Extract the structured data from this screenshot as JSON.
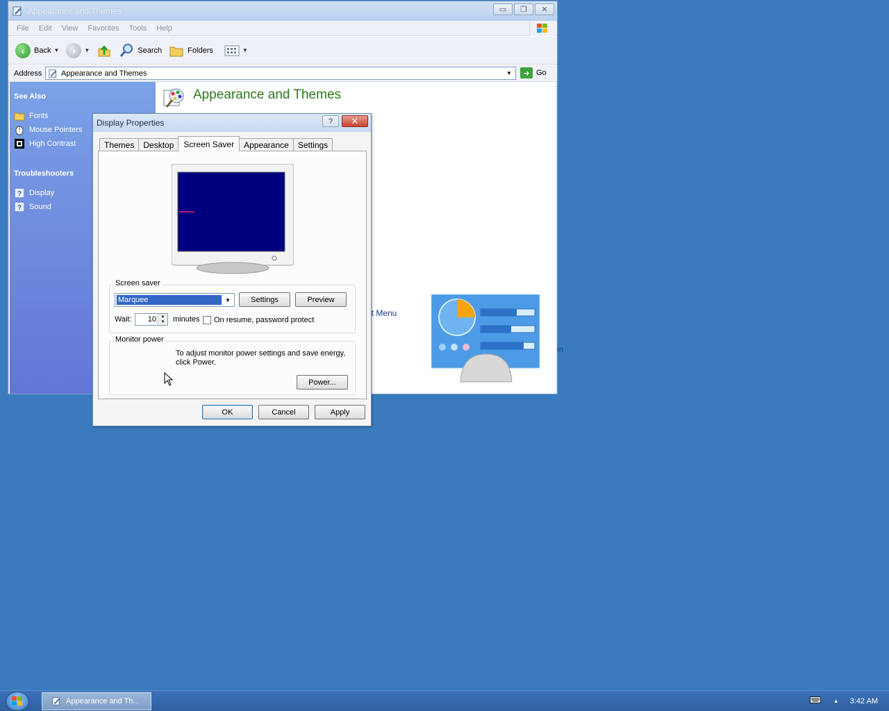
{
  "explorer": {
    "title": "Appearance and Themes",
    "menu": [
      "File",
      "Edit",
      "View",
      "Favorites",
      "Tools",
      "Help"
    ],
    "toolbar": {
      "back": "Back",
      "search": "Search",
      "folders": "Folders"
    },
    "address_label": "Address",
    "address_value": "Appearance and Themes",
    "go_label": "Go",
    "see_also_title": "See Also",
    "see_also": [
      "Fonts",
      "Mouse Pointers",
      "High Contrast"
    ],
    "troubleshooters_title": "Troubleshooters",
    "troubleshooters": [
      "Display",
      "Sound"
    ],
    "page_title": "Appearance and Themes",
    "fragment_start_menu": "art Menu",
    "fragment_in": "in"
  },
  "dialog": {
    "title": "Display Properties",
    "help": "?",
    "tabs": [
      "Themes",
      "Desktop",
      "Screen Saver",
      "Appearance",
      "Settings"
    ],
    "active_tab": "Screen Saver",
    "screensaver_group": "Screen saver",
    "screensaver_value": "Marquee",
    "settings_button": "Settings",
    "preview_button": "Preview",
    "wait_label": "Wait:",
    "wait_value": "10",
    "minutes_label": "minutes",
    "password_checkbox": "On resume, password protect",
    "password_checked": false,
    "monitor_group": "Monitor power",
    "monitor_text_1": "To adjust monitor power settings and save energy,",
    "monitor_text_2": "click Power.",
    "power_button": "Power...",
    "ok": "OK",
    "cancel": "Cancel",
    "apply": "Apply",
    "preview_screen_color": "#00007f"
  },
  "taskbar": {
    "task_label": "Appearance and Th...",
    "clock": "3:42 AM"
  },
  "colors": {
    "desktop": "#3a7bbf",
    "link_green": "#2c7a1a",
    "selection": "#3166c5"
  }
}
